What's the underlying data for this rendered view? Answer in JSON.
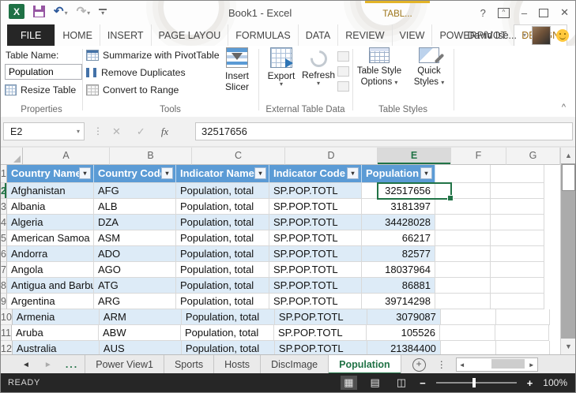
{
  "window": {
    "title": "Book1 - Excel"
  },
  "ribbon": {
    "contextual_label": "TABL...",
    "user_name": "David Ise...",
    "tabs": [
      "FILE",
      "HOME",
      "INSERT",
      "PAGE LAYOU",
      "FORMULAS",
      "DATA",
      "REVIEW",
      "VIEW",
      "POWERPIVOT",
      "DESIGN"
    ],
    "properties_group": {
      "label": "Properties",
      "table_name_label": "Table Name:",
      "table_name_value": "Population",
      "resize_table_label": "Resize Table"
    },
    "tools_group": {
      "label": "Tools",
      "summarize_label": "Summarize with PivotTable",
      "remove_duplicates_label": "Remove Duplicates",
      "convert_label": "Convert to Range",
      "insert_slicer_line1": "Insert",
      "insert_slicer_line2": "Slicer"
    },
    "external_group": {
      "label": "External Table Data",
      "export_label": "Export",
      "refresh_label": "Refresh"
    },
    "styles_group": {
      "label": "Table Styles",
      "options_line1": "Table Style",
      "options_line2": "Options",
      "quick_line1": "Quick",
      "quick_line2": "Styles"
    }
  },
  "formula_bar": {
    "name_box": "E2",
    "value": "32517656"
  },
  "grid": {
    "column_letters": [
      "A",
      "B",
      "C",
      "D",
      "E",
      "F",
      "G"
    ],
    "header_row_number": "1",
    "header_cells": [
      "Country Name",
      "Country Code",
      "Indicator Name",
      "Indicator Code",
      "Population"
    ],
    "rows": [
      {
        "num": "2",
        "name": "Afghanistan",
        "code": "AFG",
        "indicator": "Population, total",
        "icode": "SP.POP.TOTL",
        "value": "32517656"
      },
      {
        "num": "3",
        "name": "Albania",
        "code": "ALB",
        "indicator": "Population, total",
        "icode": "SP.POP.TOTL",
        "value": "3181397"
      },
      {
        "num": "4",
        "name": "Algeria",
        "code": "DZA",
        "indicator": "Population, total",
        "icode": "SP.POP.TOTL",
        "value": "34428028"
      },
      {
        "num": "5",
        "name": "American Samoa",
        "code": "ASM",
        "indicator": "Population, total",
        "icode": "SP.POP.TOTL",
        "value": "66217"
      },
      {
        "num": "6",
        "name": "Andorra",
        "code": "ADO",
        "indicator": "Population, total",
        "icode": "SP.POP.TOTL",
        "value": "82577"
      },
      {
        "num": "7",
        "name": "Angola",
        "code": "AGO",
        "indicator": "Population, total",
        "icode": "SP.POP.TOTL",
        "value": "18037964"
      },
      {
        "num": "8",
        "name": "Antigua and Barbu",
        "code": "ATG",
        "indicator": "Population, total",
        "icode": "SP.POP.TOTL",
        "value": "86881"
      },
      {
        "num": "9",
        "name": "Argentina",
        "code": "ARG",
        "indicator": "Population, total",
        "icode": "SP.POP.TOTL",
        "value": "39714298"
      },
      {
        "num": "10",
        "name": "Armenia",
        "code": "ARM",
        "indicator": "Population, total",
        "icode": "SP.POP.TOTL",
        "value": "3079087"
      },
      {
        "num": "11",
        "name": "Aruba",
        "code": "ABW",
        "indicator": "Population, total",
        "icode": "SP.POP.TOTL",
        "value": "105526"
      },
      {
        "num": "12",
        "name": "Australia",
        "code": "AUS",
        "indicator": "Population, total",
        "icode": "SP.POP.TOTL",
        "value": "21384400"
      }
    ]
  },
  "sheet_bar": {
    "more_indicator": "...",
    "tabs": [
      "Power View1",
      "Sports",
      "Hosts",
      "DiscImage",
      "Population"
    ],
    "active_tab": "Population"
  },
  "status_bar": {
    "mode": "READY",
    "zoom_level": "100%"
  },
  "icons": {
    "undo": "↶",
    "redo": "↷",
    "cancel": "✕",
    "enter": "✓",
    "function": "fx",
    "name_box_caret": "▾",
    "dropdown_caret": "▾",
    "filter_caret": "▾",
    "help": "?",
    "minimize": "–",
    "close": "✕",
    "ribbon_display_caret": "^",
    "collapse_ribbon": "^",
    "vertical_dots": "⋮",
    "formula_dots": "⋮",
    "sheet_prev": "◄",
    "sheet_next": "►",
    "scroll_up": "▲",
    "scroll_down": "▼",
    "scroll_left": "◄",
    "scroll_right": "►",
    "new_sheet": "+",
    "normal_view": "▦",
    "page_layout_view": "▤",
    "page_break_view": "◫",
    "zoom_out": "−",
    "zoom_in": "+",
    "excel_logo": "X"
  },
  "colors": {
    "excel_green": "#217346",
    "table_header_blue": "#5b9bd5",
    "banded_row_blue": "#ddebf7",
    "contextual_tab_gold": "#9d7519",
    "status_bar_dark": "#262626"
  }
}
